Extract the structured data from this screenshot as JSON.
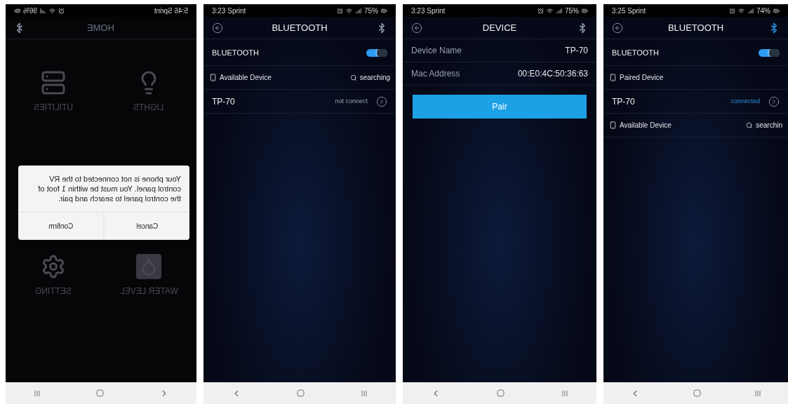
{
  "screens": [
    {
      "kind": "home",
      "mirrored": true,
      "status": {
        "carrier": "5:46 Sprint",
        "battery": "96%"
      },
      "title": "HOME",
      "bt_active": false,
      "tiles": [
        {
          "label": "UTILITIES",
          "kind": "utilities"
        },
        {
          "label": "LIGHTS",
          "kind": "bulb"
        },
        {
          "label": "SETTING",
          "kind": "gear"
        },
        {
          "label": "WATER LEVEL",
          "kind": "water"
        }
      ],
      "dialog": {
        "message": "Your phone is not connected to the RV control panel. You must be within 1 foot of the control panel to search and pair.",
        "buttons": [
          "Confirm",
          "Cancel"
        ]
      }
    },
    {
      "kind": "bluetooth",
      "mirrored": false,
      "status": {
        "carrier": "3:23 Sprint",
        "battery": "75%"
      },
      "title": "BLUETOOTH",
      "bt_active": false,
      "toggle": {
        "label": "BLUETOOTH",
        "on": true
      },
      "rows": [
        {
          "kind": "section",
          "label": "Available Device",
          "status": "searching"
        },
        {
          "kind": "device",
          "name": "TP-70",
          "status": "not connect",
          "connected": false
        }
      ]
    },
    {
      "kind": "device",
      "mirrored": false,
      "status": {
        "carrier": "3:23 Sprint",
        "battery": "75%"
      },
      "title": "DEVICE",
      "bt_active": false,
      "fields": [
        {
          "label": "Device Name",
          "value": "TP-70"
        },
        {
          "label": "Mac Address",
          "value": "00:E0:4C:50:36:63"
        }
      ],
      "button": "Pair"
    },
    {
      "kind": "bluetooth",
      "mirrored": false,
      "status": {
        "carrier": "3:25 Sprint",
        "battery": "74%"
      },
      "title": "BLUETOOTH",
      "bt_active": true,
      "toggle": {
        "label": "BLUETOOTH",
        "on": true
      },
      "rows": [
        {
          "kind": "section",
          "label": "Paired Device"
        },
        {
          "kind": "device",
          "name": "TP-70",
          "status": "connected",
          "connected": true
        },
        {
          "kind": "section",
          "label": "Available Device",
          "status": "searchin"
        }
      ]
    }
  ]
}
